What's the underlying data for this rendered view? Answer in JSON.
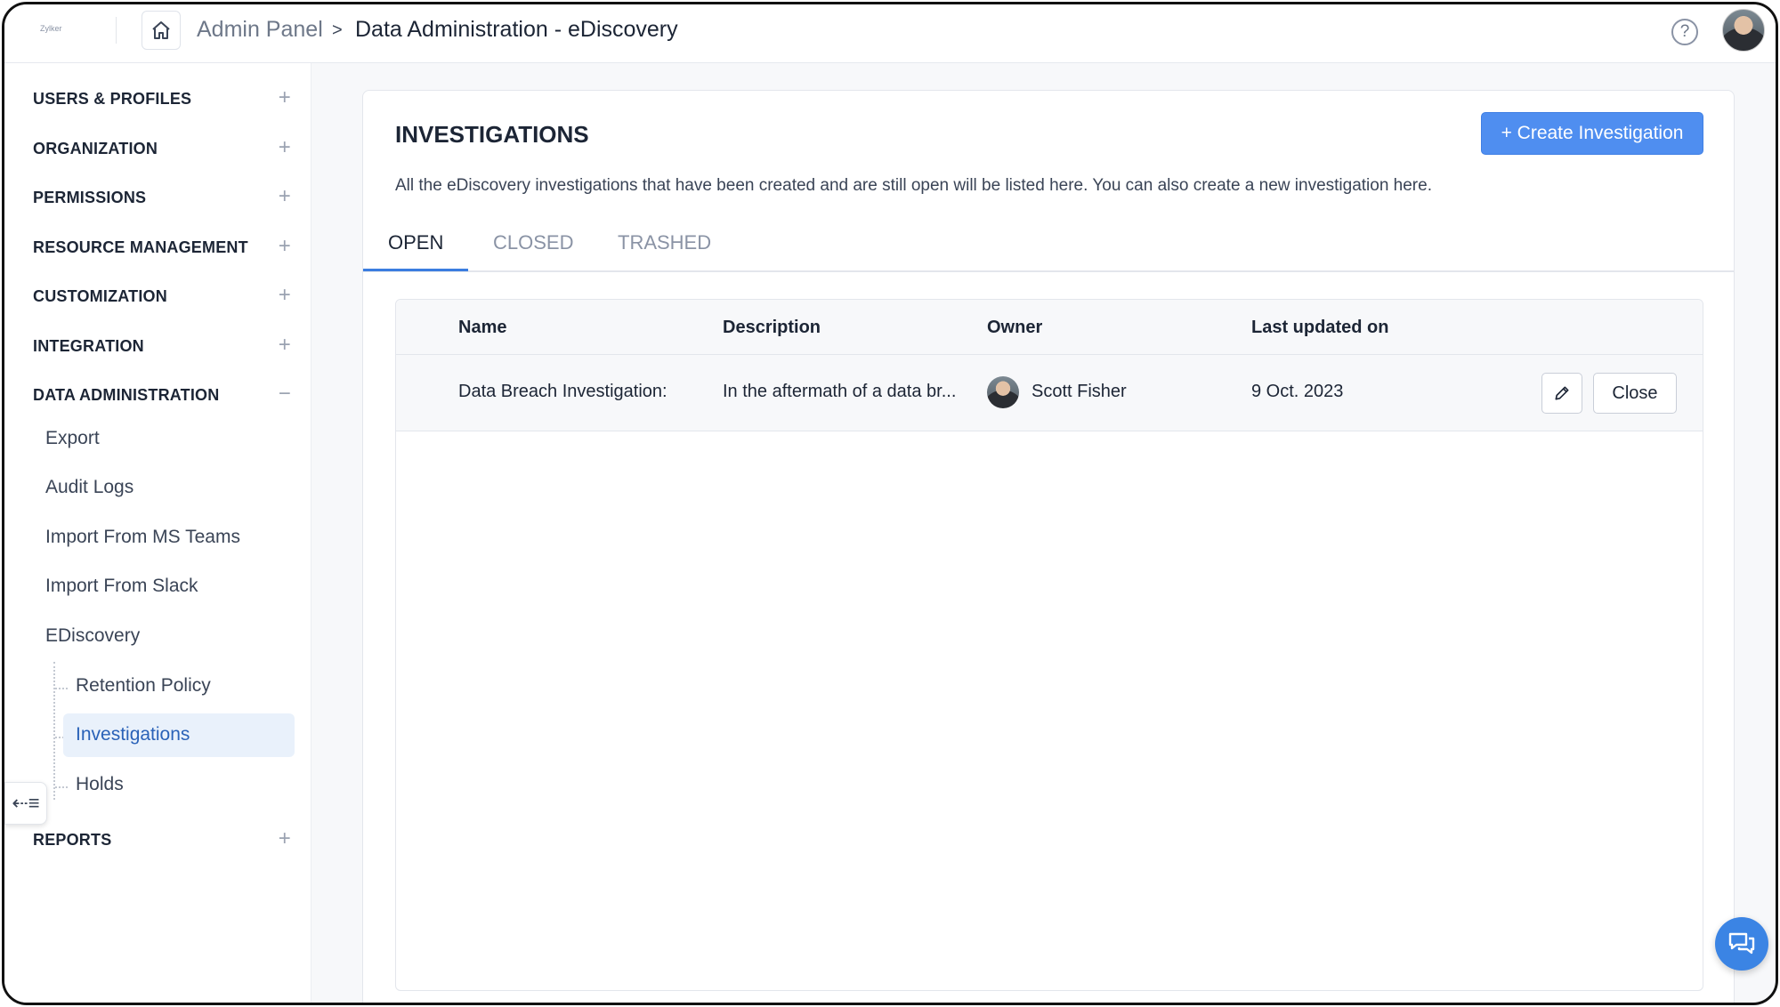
{
  "header": {
    "logo_text": "Zylker",
    "breadcrumb_root": "Admin Panel",
    "breadcrumb_separator": ">",
    "breadcrumb_current": "Data Administration - eDiscovery",
    "help_symbol": "?"
  },
  "sidebar": {
    "sections": [
      {
        "label": "USERS & PROFILES",
        "toggle": "+"
      },
      {
        "label": "ORGANIZATION",
        "toggle": "+"
      },
      {
        "label": "PERMISSIONS",
        "toggle": "+"
      },
      {
        "label": "RESOURCE MANAGEMENT",
        "toggle": "+"
      },
      {
        "label": "CUSTOMIZATION",
        "toggle": "+"
      },
      {
        "label": "INTEGRATION",
        "toggle": "+"
      },
      {
        "label": "DATA ADMINISTRATION",
        "toggle": "−"
      },
      {
        "label": "REPORTS",
        "toggle": "+"
      }
    ],
    "data_admin_items": [
      "Export",
      "Audit Logs",
      "Import From MS Teams",
      "Import From Slack",
      "EDiscovery"
    ],
    "ediscovery_items": [
      "Retention Policy",
      "Investigations",
      "Holds"
    ],
    "active_item": "Investigations",
    "collapse_symbol": "⇠≡"
  },
  "main": {
    "title": "INVESTIGATIONS",
    "create_button": "+ Create Investigation",
    "description": "All the eDiscovery investigations that have been created and are still open will be listed here. You can also create a new investigation here.",
    "tabs": [
      {
        "label": "OPEN",
        "active": true
      },
      {
        "label": "CLOSED",
        "active": false
      },
      {
        "label": "TRASHED",
        "active": false
      }
    ],
    "table": {
      "columns": [
        "Name",
        "Description",
        "Owner",
        "Last updated on"
      ],
      "rows": [
        {
          "name": "Data Breach Investigation:",
          "description": "In the aftermath of a data br...",
          "owner": "Scott Fisher",
          "updated": "9 Oct. 2023",
          "close_label": "Close"
        }
      ]
    }
  },
  "colors": {
    "accent": "#4f8ef0",
    "active_bg": "#e9f1fb",
    "active_text": "#2a62b8"
  }
}
